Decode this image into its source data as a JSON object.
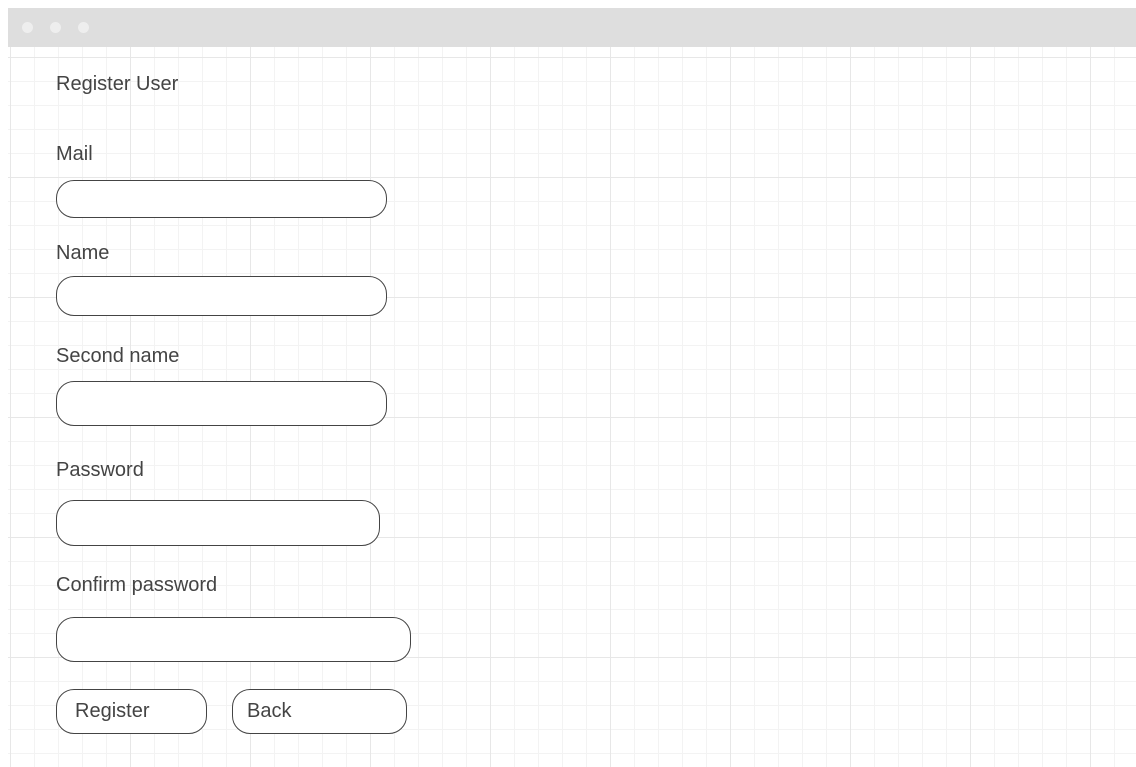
{
  "window": {
    "titlebar_dots": [
      "close-dot",
      "minimize-dot",
      "maximize-dot"
    ]
  },
  "form": {
    "title": "Register User",
    "fields": {
      "mail": {
        "label": "Mail",
        "value": ""
      },
      "name": {
        "label": "Name",
        "value": ""
      },
      "second_name": {
        "label": "Second name",
        "value": ""
      },
      "password": {
        "label": "Password",
        "value": ""
      },
      "confirm_password": {
        "label": "Confirm password",
        "value": ""
      }
    },
    "buttons": {
      "register_label": "Register",
      "back_label": "Back"
    }
  }
}
